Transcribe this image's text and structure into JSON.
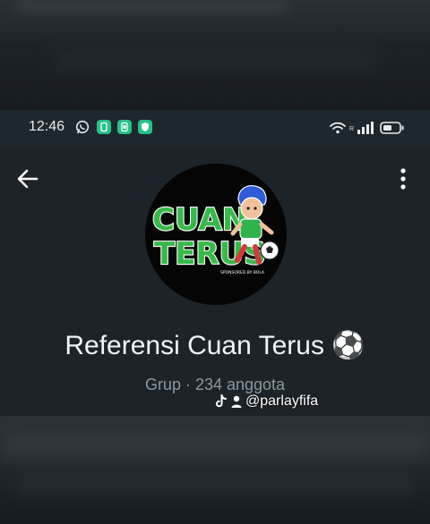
{
  "status_bar": {
    "time": "12:46",
    "network_label": "R",
    "notification_icons": [
      "whatsapp-icon",
      "app-icon",
      "app-icon",
      "shield-icon"
    ],
    "system_icons": [
      "wifi-icon",
      "signal-icon",
      "battery-icon"
    ]
  },
  "header": {
    "back_icon": "arrow-left-icon",
    "menu_icon": "more-vert-icon",
    "avatar": {
      "line1": "CUAN",
      "line2": "TERUS",
      "tagline": "SPONSORED BY BOLA"
    },
    "group_name": "Referensi Cuan Terus",
    "group_emoji": "⚽",
    "group_meta": "Grup · 234 anggota"
  },
  "watermark": {
    "handle": "@parlayfifa"
  },
  "colors": {
    "background": "#151a1f",
    "status_bar": "#1f272e",
    "header": "#1c2329",
    "logo_green": "#37b94a",
    "app_icon_green": "#27c08a"
  }
}
